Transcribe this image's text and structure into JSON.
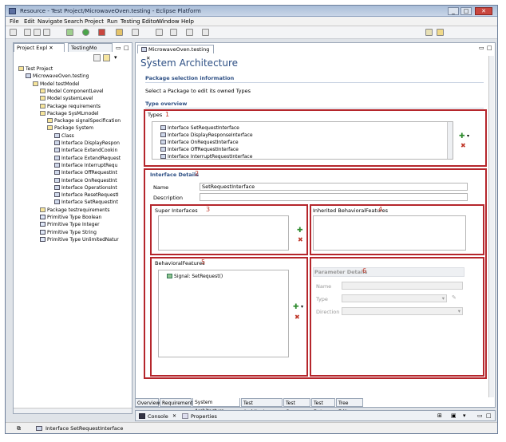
{
  "window": {
    "title": "Resource - Test Project/MicrowaveOven.testing - Eclipse Platform"
  },
  "menu": [
    "File",
    "Edit",
    "Navigate",
    "Search",
    "Project",
    "Run",
    "Testing Editor",
    "Window",
    "Help"
  ],
  "left_pane": {
    "tabs": [
      "Project Expl",
      "TestingMo"
    ],
    "tree": [
      {
        "label": "Test Project",
        "level": 0,
        "icon": "project-icon"
      },
      {
        "label": "MicrowaveOven.testing",
        "level": 1,
        "icon": "model-file-icon"
      },
      {
        "label": "Model testModel",
        "level": 2,
        "icon": "package-icon"
      },
      {
        "label": "Model ComponentLevel",
        "level": 3,
        "icon": "package-icon"
      },
      {
        "label": "Model systemLevel",
        "level": 3,
        "icon": "package-icon"
      },
      {
        "label": "Package requirements",
        "level": 3,
        "icon": "package-icon"
      },
      {
        "label": "Package SysMLmodel",
        "level": 3,
        "icon": "package-icon"
      },
      {
        "label": "Package signalSpecification",
        "level": 4,
        "icon": "package-icon"
      },
      {
        "label": "Package System",
        "level": 4,
        "icon": "package-icon"
      },
      {
        "label": "Class",
        "level": 5,
        "icon": "class-icon"
      },
      {
        "label": "Interface DisplayRespon",
        "level": 5,
        "icon": "interface-icon"
      },
      {
        "label": "Interface ExtendCookin",
        "level": 5,
        "icon": "interface-icon"
      },
      {
        "label": "Interface ExtendRequest",
        "level": 5,
        "icon": "interface-icon"
      },
      {
        "label": "Interface InterruptRequ",
        "level": 5,
        "icon": "interface-icon"
      },
      {
        "label": "Interface OffRequestInt",
        "level": 5,
        "icon": "interface-icon"
      },
      {
        "label": "Interface OnRequestInt",
        "level": 5,
        "icon": "interface-icon"
      },
      {
        "label": "Interface OperationsInt",
        "level": 5,
        "icon": "interface-icon"
      },
      {
        "label": "Interface ResetRequestI",
        "level": 5,
        "icon": "interface-icon"
      },
      {
        "label": "Interface SetRequestInt",
        "level": 5,
        "icon": "interface-icon"
      },
      {
        "label": "Package testrequirements",
        "level": 3,
        "icon": "package-icon"
      },
      {
        "label": "Primitive Type Boolean",
        "level": 3,
        "icon": "primitive-icon"
      },
      {
        "label": "Primitive Type Integer",
        "level": 3,
        "icon": "primitive-icon"
      },
      {
        "label": "Primitive Type String",
        "level": 3,
        "icon": "primitive-icon"
      },
      {
        "label": "Primitive Type UnlimitedNatur",
        "level": 3,
        "icon": "primitive-icon"
      }
    ]
  },
  "editor": {
    "tab": "MicrowaveOven.testing",
    "title": "System Architecture",
    "package_section": {
      "heading": "Package selection information",
      "hint": "Select a Package to edit its owned Types"
    },
    "type_overview": {
      "heading": "Type overview"
    },
    "types": {
      "label": "Types",
      "marker": "1",
      "items": [
        "Interface SetRequestInterface",
        "Interface DisplayResponseInterface",
        "Interface OnRequestInterface",
        "Interface OffRequestInterface",
        "Interface InterruptRequestInterface"
      ]
    },
    "interface_details": {
      "heading": "Interface Details",
      "marker": "2",
      "name_label": "Name",
      "name_value": "SetRequestInterface",
      "description_label": "Description",
      "description_value": ""
    },
    "super_interfaces": {
      "label": "Super Interfaces",
      "marker": "3"
    },
    "inherited_features": {
      "label": "Inherited BehavioralFeatures",
      "marker": "4"
    },
    "behavioral_features": {
      "label": "BehavioralFeatures",
      "marker": "5",
      "items": [
        "Signal: SetRequest()"
      ]
    },
    "parameter_details": {
      "heading": "Parameter Details",
      "marker": "6",
      "name_label": "Name",
      "type_label": "Type",
      "direction_label": "Direction"
    },
    "bottom_tabs": [
      "Overview",
      "Requirements",
      "System Architecture",
      "Test Architecture",
      "Test Cases",
      "Test Data",
      "Tree Editor"
    ],
    "active_bottom_tab": "System Architecture"
  },
  "console": {
    "tabs": [
      "Console",
      "Properties"
    ]
  },
  "status": {
    "text": "Interface SetRequestInterface"
  },
  "colors": {
    "accent": "#b5262c",
    "heading": "#2d4f84"
  }
}
